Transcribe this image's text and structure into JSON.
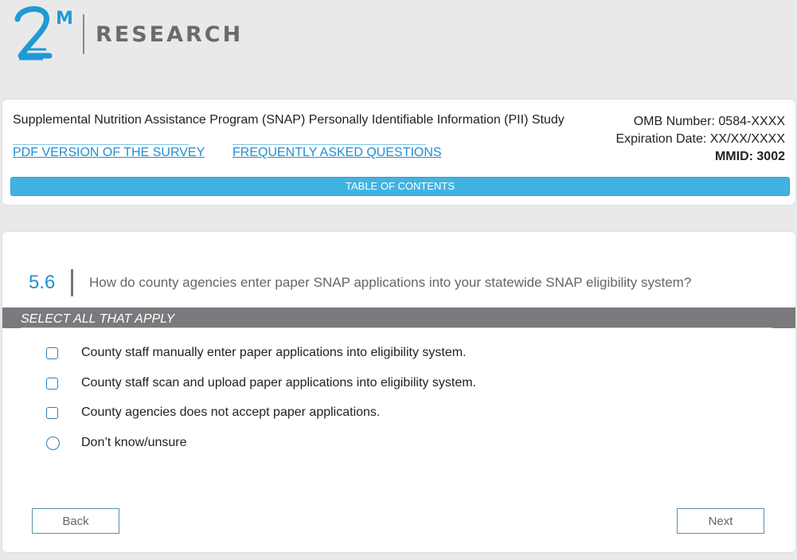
{
  "brand": {
    "mark_text": "2M",
    "name": "RESEARCH",
    "accent_color": "#1f9ad6"
  },
  "header": {
    "study_title": "Supplemental Nutrition Assistance Program (SNAP) Personally Identifiable Information (PII) Study",
    "pdf_link": "PDF VERSION OF THE SURVEY",
    "faq_link": "FREQUENTLY ASKED QUESTIONS",
    "omb_number": "OMB Number: 0584-XXXX",
    "expiration": "Expiration Date: XX/XX/XXXX",
    "mmid": "MMID: 3002",
    "toc_label": "TABLE OF CONTENTS"
  },
  "question": {
    "number": "5.6",
    "text": "How do county agencies enter paper SNAP applications into your statewide SNAP eligibility system?",
    "instruction": "SELECT ALL THAT APPLY",
    "options": [
      {
        "label": "County staff manually enter paper applications into eligibility system.",
        "type": "checkbox",
        "checked": false
      },
      {
        "label": "County staff scan and upload paper applications into eligibility system.",
        "type": "checkbox",
        "checked": false
      },
      {
        "label": "County agencies does not accept paper applications.",
        "type": "checkbox",
        "checked": false
      },
      {
        "label": "Don’t know/unsure",
        "type": "radio",
        "checked": false
      }
    ]
  },
  "navigation": {
    "back_label": "Back",
    "next_label": "Next"
  }
}
